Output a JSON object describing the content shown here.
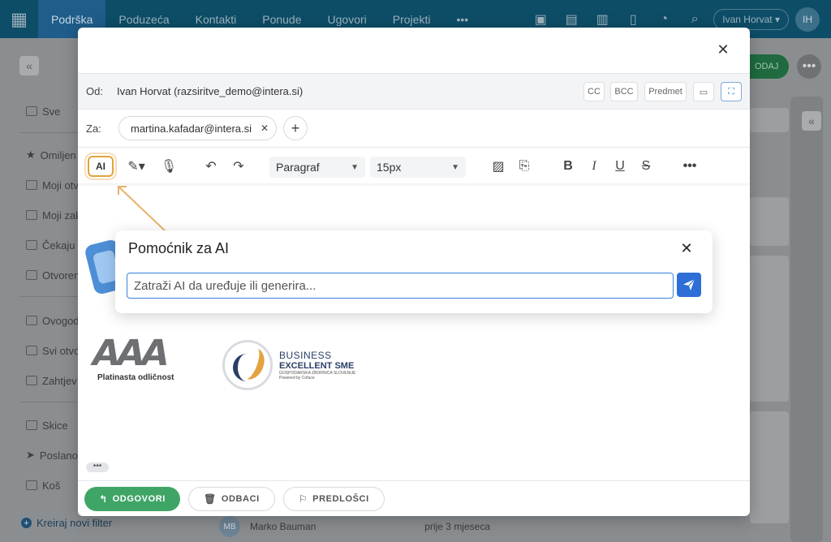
{
  "nav": {
    "items": [
      "Podrška",
      "Poduzeća",
      "Kontakti",
      "Ponude",
      "Ugovori",
      "Projekti"
    ],
    "more": "•••",
    "user_name": "Ivan Horvat",
    "user_initials": "IH"
  },
  "sidebar": {
    "items": [
      "Sve",
      "Omiljen",
      "Moji otvo",
      "Moji zak",
      "Čekaju",
      "Otvoren",
      "Ovogod",
      "Svi otvo",
      "Zahtjev",
      "Skice",
      "Poslano",
      "Koš"
    ],
    "new_filter": "Kreiraj novi filter"
  },
  "right": {
    "add_label": "ODAJ",
    "more": "•••"
  },
  "background_row": {
    "initials": "MB",
    "name": "Marko Bauman",
    "time": "prije 3 mjeseca"
  },
  "modal": {
    "from_label": "Od:",
    "from_value": "Ivan  Horvat (razsiritve_demo@intera.si)",
    "cc": "CC",
    "bcc": "BCC",
    "subject": "Predmet",
    "to_label": "Za:",
    "recipient": "martina.kafadar@intera.si",
    "toolbar": {
      "ai": "AI",
      "paragraph": "Paragraf",
      "font_size": "15px"
    },
    "logo_aaa_caption": "Platinasta odličnost",
    "logo_sme_line1": "BUSINESS",
    "logo_sme_line2": "EXCELLENT SME",
    "logo_sme_line3": "GOSPODARSKA ZBORNICA SLOVENIJE",
    "logo_sme_line4": "Powered by Coface",
    "footer": {
      "reply": "ODGOVORI",
      "discard": "ODBACI",
      "templates": "PREDLOŠCI"
    }
  },
  "ai_popup": {
    "title": "Pomoćnik za AI",
    "placeholder": "Zatraži AI da uređuje ili generira..."
  },
  "colors": {
    "accent": "#3fa566",
    "highlight": "#e3a43b",
    "send": "#2d6fd6"
  }
}
